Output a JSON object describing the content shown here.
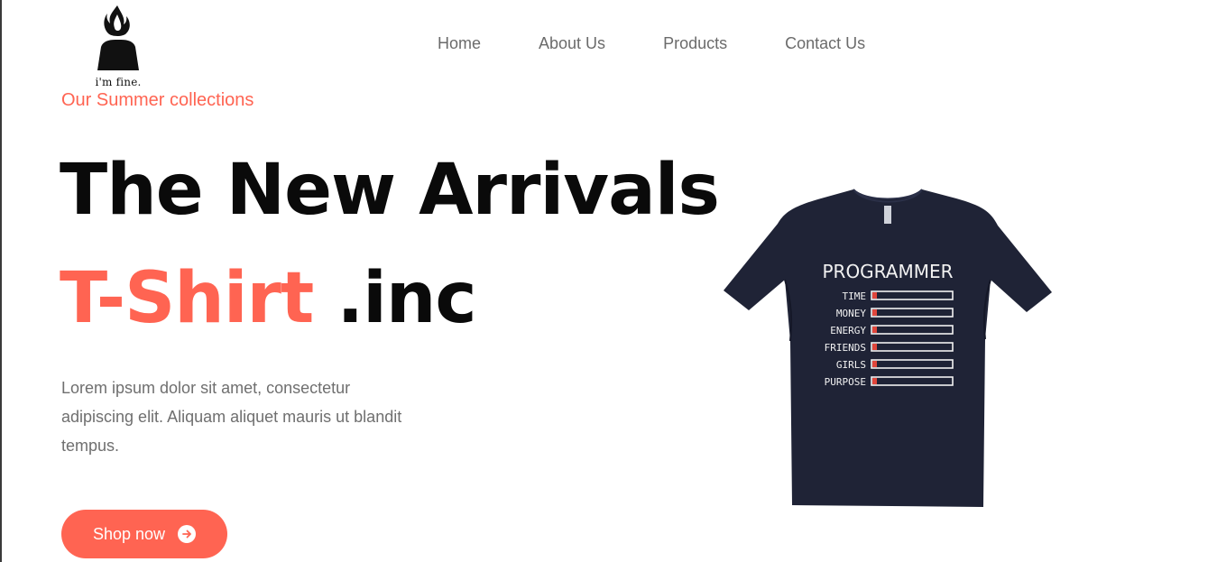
{
  "logo": {
    "text": "i'm fine."
  },
  "nav": {
    "items": [
      "Home",
      "About Us",
      "Products",
      "Contact Us"
    ]
  },
  "hero": {
    "eyebrow": "Our Summer collections",
    "title_line1": "The New Arrivals",
    "title_accent": "T-Shirt",
    "title_rest": " .inc",
    "description": "Lorem ipsum dolor sit amet, consectetur adipiscing elit. Aliquam aliquet mauris ut blandit tempus.",
    "cta_label": "Shop now"
  },
  "product_image": {
    "heading": "PROGRAMMER",
    "bars": [
      "TIME",
      "MONEY",
      "ENERGY",
      "FRIENDS",
      "GIRLS",
      "PURPOSE"
    ]
  },
  "colors": {
    "accent": "#ff6452",
    "shirt": "#1f2336"
  }
}
